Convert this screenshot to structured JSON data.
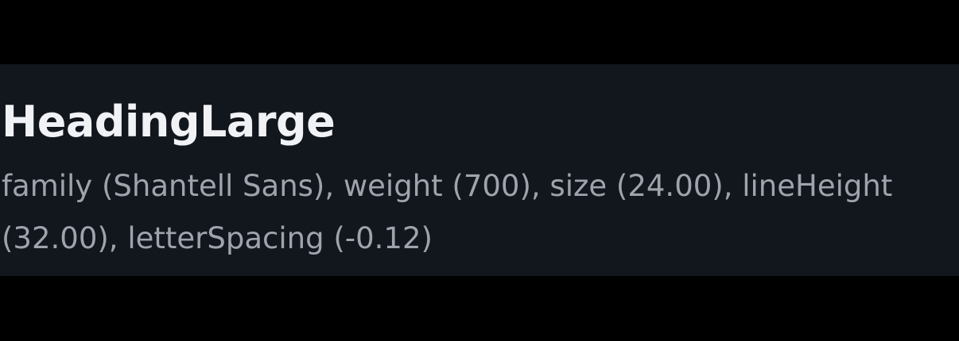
{
  "token": {
    "name": "HeadingLarge",
    "description": "family (Shantell Sans), weight (700), size (24.00), lineHeight (32.00), letterSpacing (-0.12)"
  },
  "colors": {
    "background": "#000000",
    "panel": "#12161d",
    "heading": "#f0f2f5",
    "description": "#9ea4ad"
  }
}
